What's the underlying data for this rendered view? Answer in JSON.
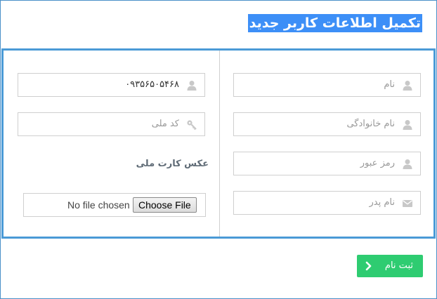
{
  "header": {
    "title": "تکمیل اطلاعات کاربر جدید"
  },
  "form": {
    "right_column": {
      "first_name_placeholder": "نام",
      "last_name_placeholder": "نام خانوادگی",
      "password_placeholder": "رمز عبور",
      "father_name_placeholder": "نام پدر"
    },
    "left_column": {
      "phone_value": "۰۹۳۵۶۵۰۵۴۶۸",
      "national_code_placeholder": "کد ملی",
      "id_card_label": "عکس کارت ملی",
      "file_button_label": "Choose File",
      "file_status": "No file chosen"
    }
  },
  "actions": {
    "submit_label": "ثبت نام"
  },
  "colors": {
    "accent": "#3d8ff7",
    "panel_border": "#4a9ad6",
    "submit": "#2ecc71",
    "icon": "#c8c8c8"
  },
  "icons": {
    "user": "user-icon",
    "key": "key-icon",
    "envelope": "envelope-icon",
    "chevron": "chevron-left-icon"
  }
}
